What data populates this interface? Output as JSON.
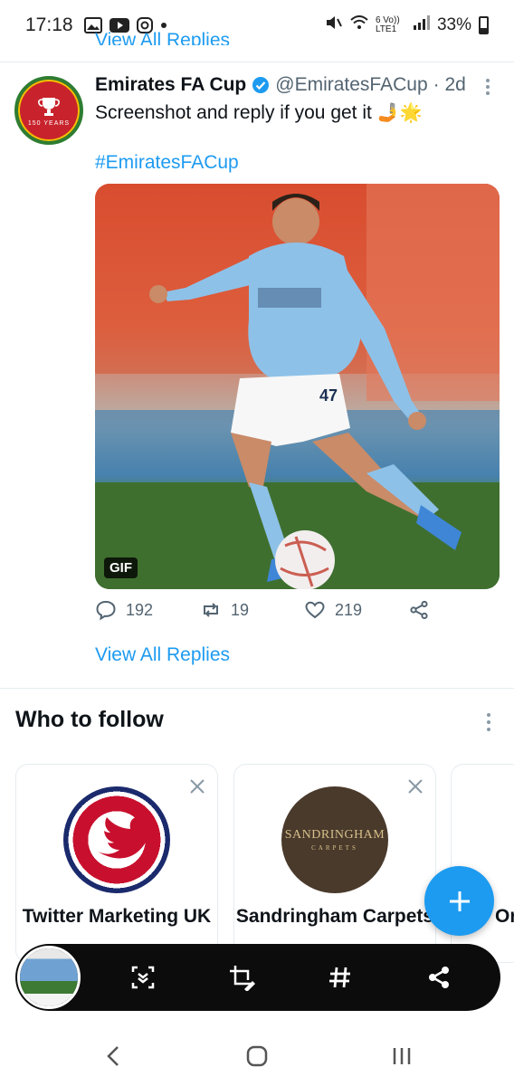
{
  "status_bar": {
    "time": "17:18",
    "network": "6 Vo)) LTE1",
    "battery": "33%"
  },
  "previous_reply_link": "View All Replies",
  "tweet": {
    "author_name": "Emirates FA Cup",
    "handle": "@EmiratesFACup",
    "time": "· 2d",
    "text": "Screenshot and reply if you get it",
    "emoji": "🤳🌟",
    "hashtag": "#EmiratesFACup",
    "avatar_caption": "150 YEARS",
    "media_badge": "GIF",
    "player_number": "47",
    "replies": "192",
    "retweets": "19",
    "likes": "219",
    "view_replies": "View All Replies"
  },
  "who_to_follow": {
    "title": "Who to follow",
    "cards": [
      {
        "name": "Twitter Marketing UK",
        "avatar": "twitter-bird-roundel"
      },
      {
        "name": "Sandringham Carpets",
        "avatar_line1": "SANDRINGHAM",
        "avatar_line2": "CARPETS"
      },
      {
        "name": "Or",
        "handle": "@"
      }
    ]
  },
  "colors": {
    "accent": "#1d9bf0",
    "muted": "#536471",
    "toolbar": "#0c0c0c"
  },
  "toolbar_icons": [
    "scroll-capture-icon",
    "crop-edit-icon",
    "hashtag-icon",
    "share-icon"
  ],
  "nav_icons": [
    "back-icon",
    "home-icon",
    "recents-icon"
  ]
}
